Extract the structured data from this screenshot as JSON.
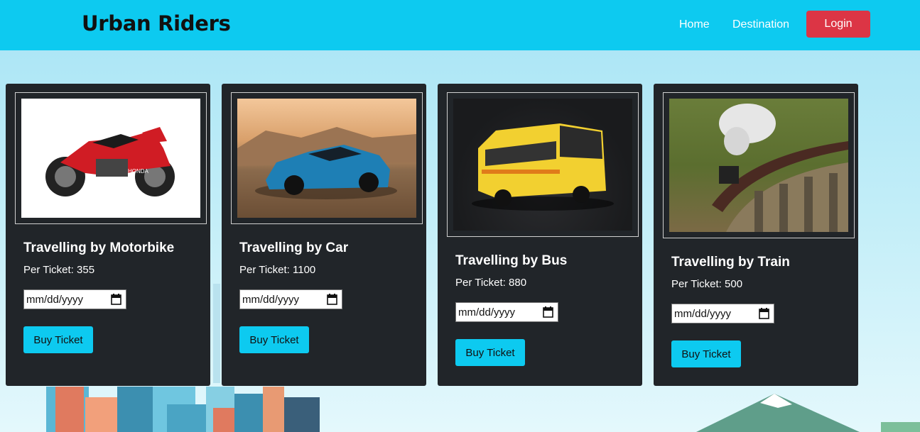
{
  "nav": {
    "brand": "Urban Riders",
    "links": [
      "Home",
      "Destination"
    ],
    "login_label": "Login"
  },
  "cards": [
    {
      "title": "Travelling by Motorbike",
      "price": "Per Ticket: 355",
      "date_placeholder": "mm/dd/yyyy",
      "button": "Buy Ticket",
      "image": "motorbike"
    },
    {
      "title": "Travelling by Car",
      "price": "Per Ticket: 1100",
      "date_placeholder": "mm/dd/yyyy",
      "button": "Buy Ticket",
      "image": "car"
    },
    {
      "title": "Travelling by Bus",
      "price": "Per Ticket: 880",
      "date_placeholder": "mm/dd/yyyy",
      "button": "Buy Ticket",
      "image": "bus"
    },
    {
      "title": "Travelling by Train",
      "price": "Per Ticket: 500",
      "date_placeholder": "mm/dd/yyyy",
      "button": "Buy Ticket",
      "image": "train"
    }
  ],
  "colors": {
    "navbar": "#0dcaf0",
    "login": "#dc3545",
    "card": "#212529",
    "button": "#0dcaf0"
  }
}
